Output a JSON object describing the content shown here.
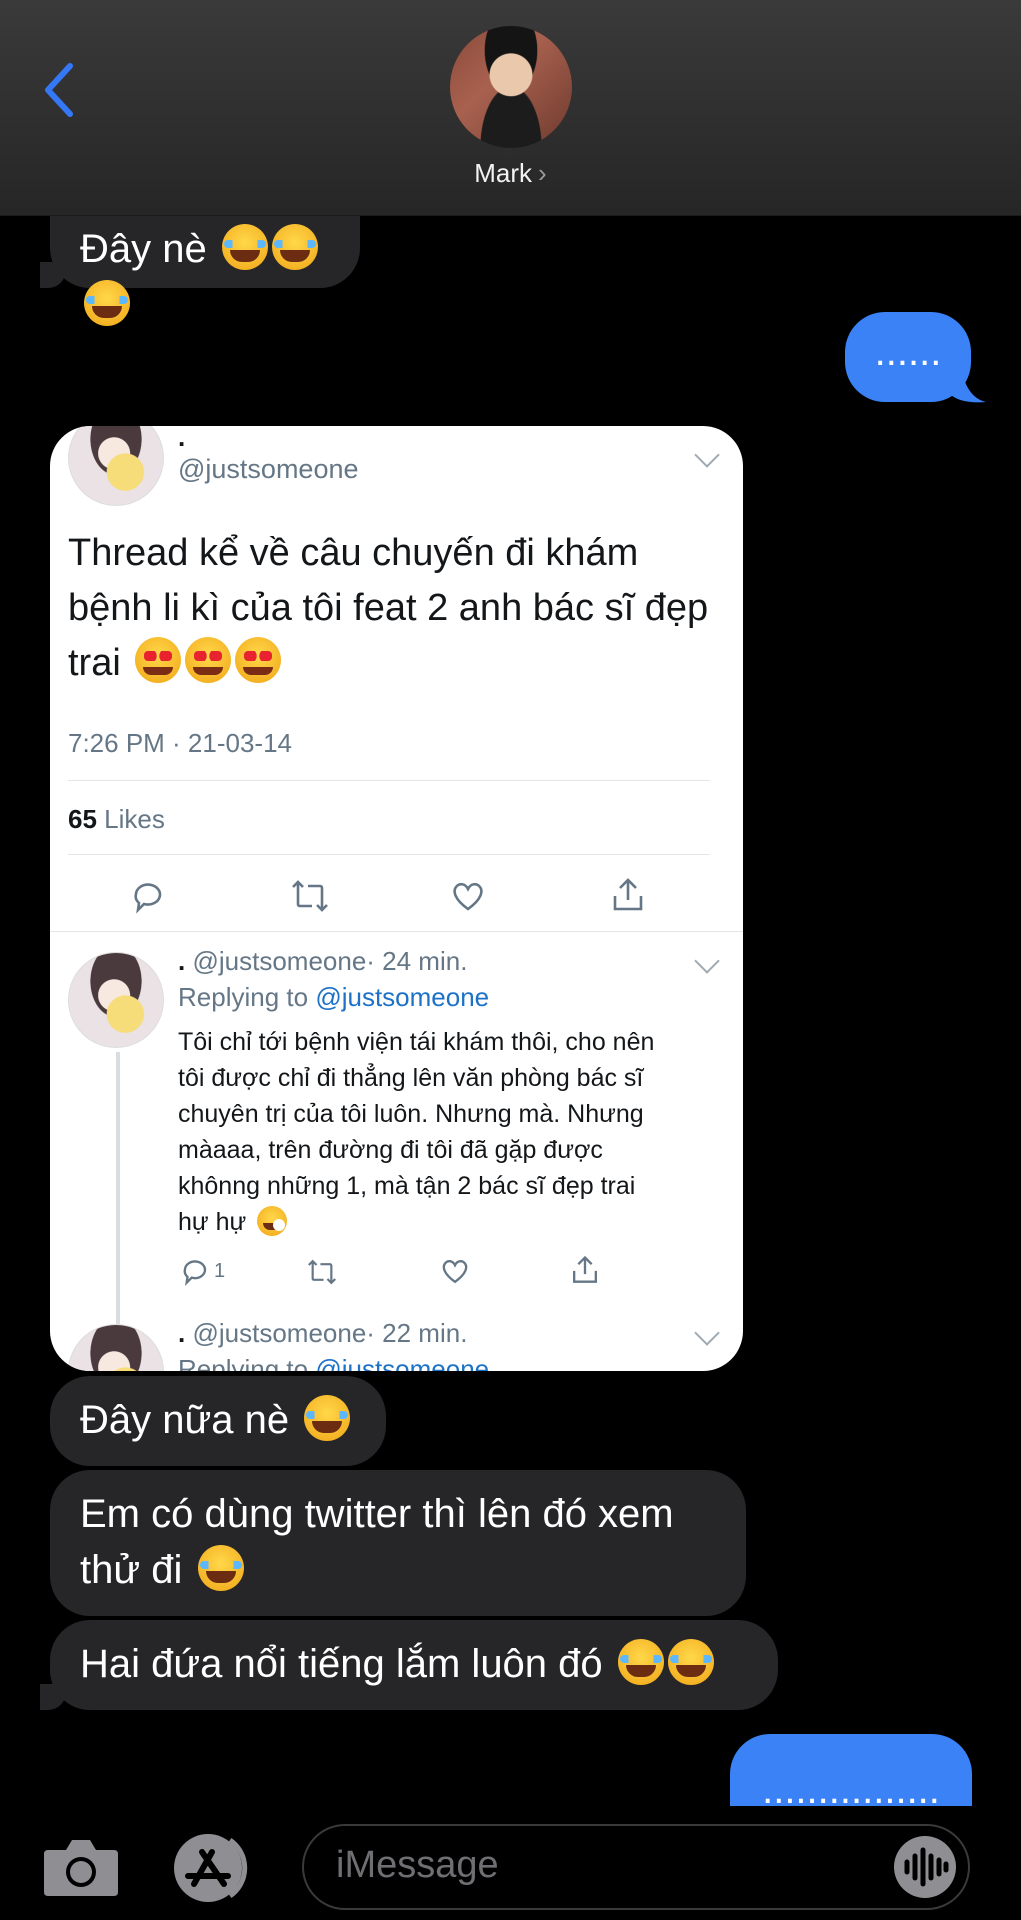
{
  "header": {
    "contact_name": "Mark"
  },
  "messages": {
    "m1": "Đây nè",
    "m2": "......",
    "m3": "Đây nữa nè",
    "m4_line1": "Em có dùng twitter thì lên đó xem",
    "m4_line2": "thử đi",
    "m5": "Hai đứa nổi tiếng lắm luôn đó",
    "m6": "................"
  },
  "tweet": {
    "name": ".",
    "handle": "@justsomeone",
    "text_line1": "Thread kể về câu chuyến đi khám",
    "text_line2": "bệnh li kì của tôi feat 2 anh bác sĩ đẹp",
    "text_line3": "trai",
    "time": "7:26 PM · 21-03-14",
    "likes_count": "65",
    "likes_label": "Likes",
    "reply1": {
      "name": ".",
      "handle": "@justsomeone",
      "age": "· 24 min.",
      "replying_label": "Replying to",
      "replying_handle": "@justsomeone",
      "lines": [
        "Tôi chỉ tới bệnh viện tái khám thôi, cho nên",
        "tôi được chỉ đi thẳng lên văn phòng bác sĩ",
        "chuyên trị của tôi luôn. Nhưng mà. Nhưng",
        "màaaa, trên đường đi tôi đã gặp được",
        "khônng những 1, mà tận 2 bác sĩ đẹp trai",
        "hự hự"
      ],
      "reply_count": "1"
    },
    "reply2": {
      "name": ".",
      "handle": "@justsomeone",
      "age": "· 22 min.",
      "replying_label": "Replying to",
      "replying_handle": "@justsomeone"
    }
  },
  "composer": {
    "placeholder": "iMessage"
  },
  "colors": {
    "outgoing": "#3b82f6",
    "incoming": "#262628",
    "accent": "#3478f6"
  }
}
